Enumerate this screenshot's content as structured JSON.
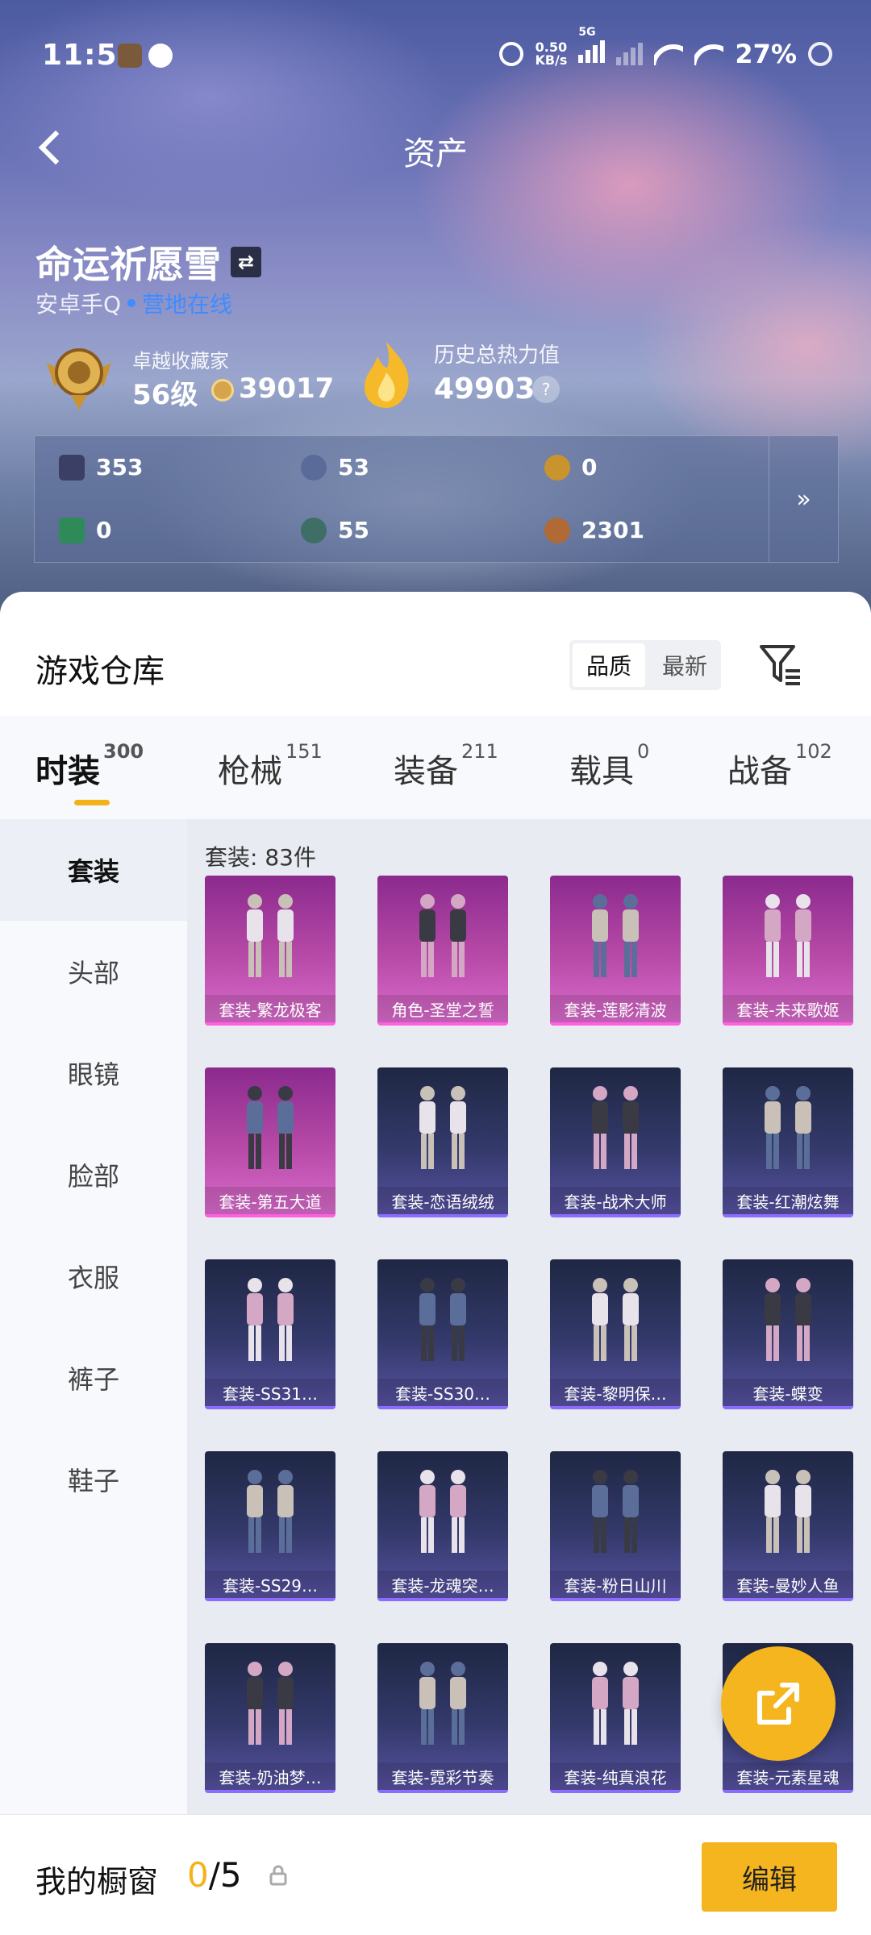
{
  "status_bar": {
    "time": "11:51",
    "net_speed_value": "0.50",
    "net_speed_unit": "KB/s",
    "network": "5G",
    "battery": "27%"
  },
  "header": {
    "title": "资产",
    "player_name": "命运祈愿雪",
    "platform": "安卓手Q",
    "online_status": "营地在线",
    "rank_title": "卓越收藏家",
    "level": "56级",
    "coins": "39017",
    "heat_label": "历史总热力值",
    "heat_value": "49903",
    "help_symbol": "?"
  },
  "resources": {
    "items": [
      {
        "icon": "card-icon",
        "value": "353",
        "color": "#3b3f66"
      },
      {
        "icon": "coupon-icon",
        "value": "53",
        "color": "#5a6b9a"
      },
      {
        "icon": "gold-coupon-icon",
        "value": "0",
        "color": "#c9932e"
      },
      {
        "icon": "ticket-icon",
        "value": "0",
        "color": "#2f8a5a"
      },
      {
        "icon": "gem-icon",
        "value": "55",
        "color": "#3e6e66"
      },
      {
        "icon": "copper-coin-icon",
        "value": "2301",
        "color": "#b06a36"
      }
    ],
    "more_symbol": "»"
  },
  "warehouse": {
    "title": "游戏仓库",
    "sort": {
      "quality": "品质",
      "newest": "最新"
    },
    "tabs": [
      {
        "label": "时装",
        "count": "300"
      },
      {
        "label": "枪械",
        "count": "151"
      },
      {
        "label": "装备",
        "count": "211"
      },
      {
        "label": "载具",
        "count": "0"
      },
      {
        "label": "战备",
        "count": "102"
      }
    ],
    "categories": [
      "套装",
      "头部",
      "眼镜",
      "脸部",
      "衣服",
      "裤子",
      "鞋子"
    ],
    "count_label": "套装: 83件",
    "items": [
      {
        "name": "套装-繁龙极客",
        "rarity": "pink"
      },
      {
        "name": "角色-圣堂之誓",
        "rarity": "pink"
      },
      {
        "name": "套装-莲影清波",
        "rarity": "pink"
      },
      {
        "name": "套装-未来歌姬",
        "rarity": "pink"
      },
      {
        "name": "套装-第五大道",
        "rarity": "pink"
      },
      {
        "name": "套装-恋语绒绒",
        "rarity": "blue"
      },
      {
        "name": "套装-战术大师",
        "rarity": "blue"
      },
      {
        "name": "套装-红潮炫舞",
        "rarity": "blue"
      },
      {
        "name": "套装-SS31…",
        "rarity": "blue"
      },
      {
        "name": "套装-SS30…",
        "rarity": "blue"
      },
      {
        "name": "套装-黎明保…",
        "rarity": "blue"
      },
      {
        "name": "套装-蝶变",
        "rarity": "blue"
      },
      {
        "name": "套装-SS29…",
        "rarity": "blue"
      },
      {
        "name": "套装-龙魂突…",
        "rarity": "blue"
      },
      {
        "name": "套装-粉日山川",
        "rarity": "blue"
      },
      {
        "name": "套装-曼妙人鱼",
        "rarity": "blue"
      },
      {
        "name": "套装-奶油梦…",
        "rarity": "blue"
      },
      {
        "name": "套装-霓彩节奏",
        "rarity": "blue"
      },
      {
        "name": "套装-纯真浪花",
        "rarity": "blue"
      },
      {
        "name": "套装-元素星魂",
        "rarity": "blue"
      }
    ]
  },
  "bottom_bar": {
    "showcase_label": "我的橱窗",
    "showcase_current": "0",
    "showcase_total": "/5",
    "edit_label": "编辑"
  },
  "colors": {
    "accent": "#f5b51e",
    "pink_rarity": "#b74aa7",
    "blue_rarity": "#3a3f72",
    "online": "#3f8cff"
  }
}
